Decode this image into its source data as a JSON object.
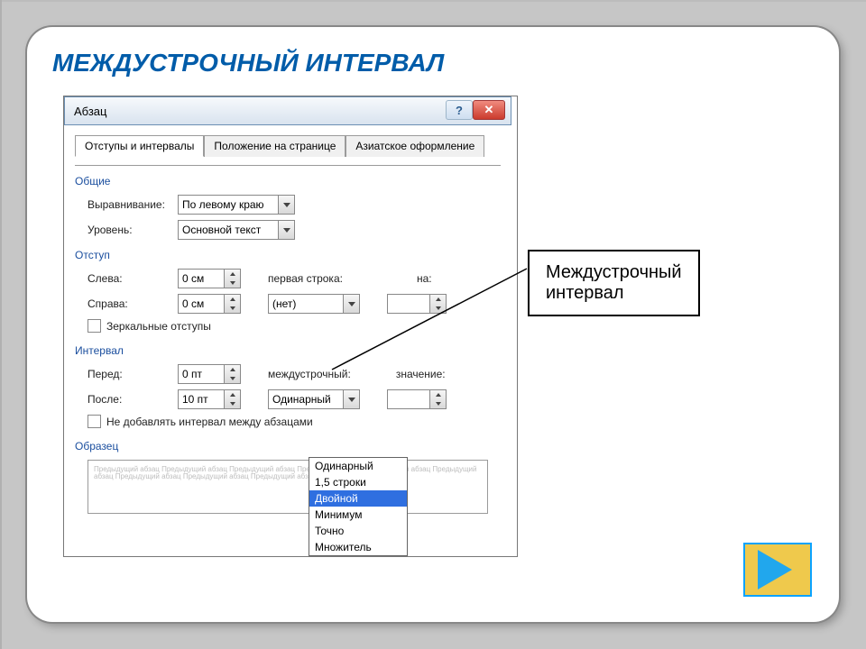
{
  "slide": {
    "title": "МЕЖДУСТРОЧНЫЙ ИНТЕРВАЛ"
  },
  "dialog": {
    "title": "Абзац",
    "help": "?",
    "close": "✕",
    "tabs": [
      "Отступы и интервалы",
      "Положение на странице",
      "Азиатское оформление"
    ],
    "section_general": "Общие",
    "align_label": "Выравнивание:",
    "align_value": "По левому краю",
    "level_label": "Уровень:",
    "level_value": "Основной текст",
    "section_indent": "Отступ",
    "left_label": "Слева:",
    "left_value": "0 см",
    "right_label": "Справа:",
    "right_value": "0 см",
    "first_line_label": "первая строка:",
    "first_line_value": "(нет)",
    "by_label": "на:",
    "mirror_label": "Зеркальные отступы",
    "section_spacing": "Интервал",
    "before_label": "Перед:",
    "before_value": "0 пт",
    "after_label": "После:",
    "after_value": "10 пт",
    "line_spacing_label": "междустрочный:",
    "line_spacing_value": "Одинарный",
    "value_label": "значение:",
    "no_space_label": "Не добавлять интервал между абзацами",
    "section_sample": "Образец",
    "sample_text": "Предыдущий абзац Предыдущий абзац Предыдущий абзац Предыдущий абзац Предыдущий абзац Предыдущий абзац Предыдущий абзац Предыдущий абзац Предыдущий абзац Пр…",
    "dropdown_options": [
      "Одинарный",
      "1,5 строки",
      "Двойной",
      "Минимум",
      "Точно",
      "Множитель"
    ],
    "dropdown_selected_index": 2
  },
  "callout": {
    "line1": "Междустрочный",
    "line2": "интервал"
  }
}
